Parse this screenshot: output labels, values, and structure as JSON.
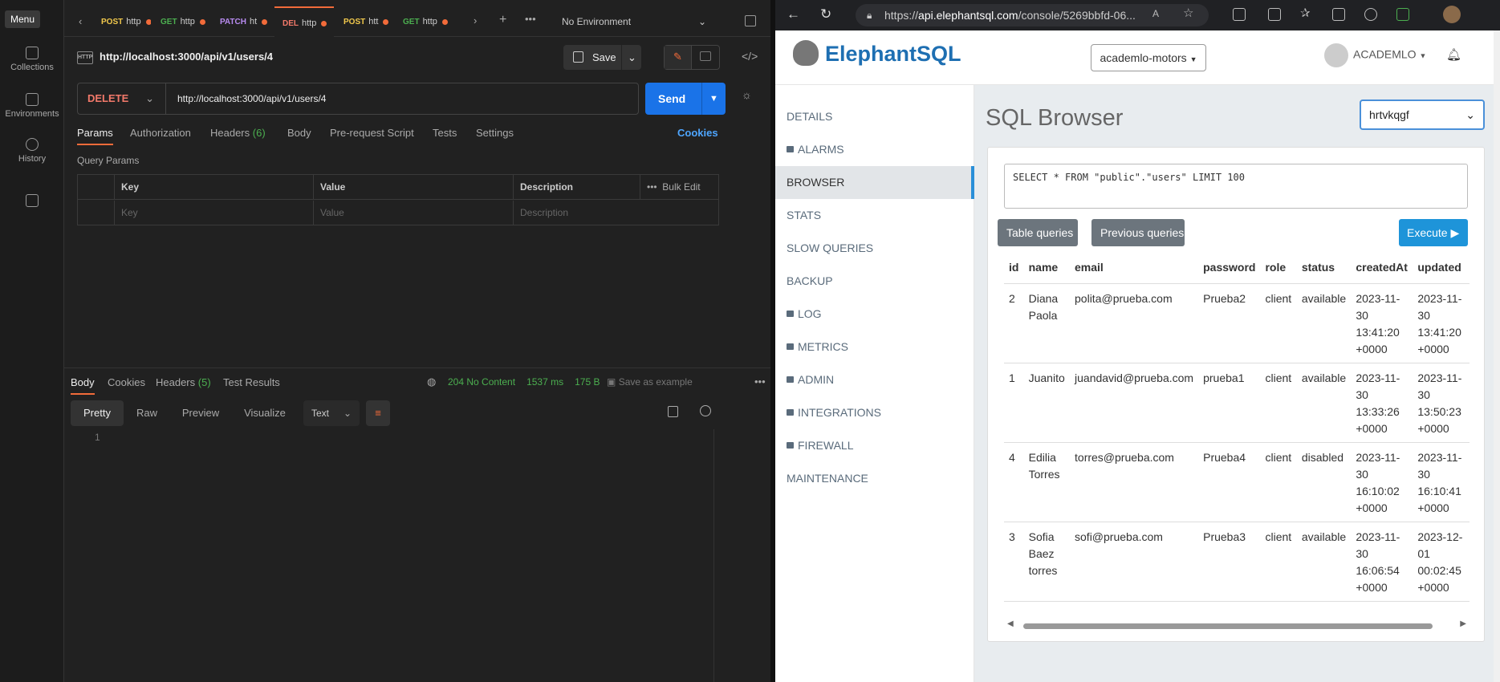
{
  "postman": {
    "sidebar": {
      "menu_label": "Menu",
      "items": [
        {
          "label": "Collections",
          "icon": "collections-icon"
        },
        {
          "label": "Environments",
          "icon": "environments-icon"
        },
        {
          "label": "History",
          "icon": "history-icon"
        },
        {
          "label": "",
          "icon": "add-workspace-icon"
        }
      ]
    },
    "tabs": [
      {
        "method": "POST",
        "text": "http",
        "color": "#f2c94c"
      },
      {
        "method": "GET",
        "text": "http",
        "color": "#4caf50"
      },
      {
        "method": "PATCH",
        "text": "ht",
        "color": "#b88bf0"
      },
      {
        "method": "DEL",
        "text": "http",
        "color": "#f2796a",
        "active": true
      },
      {
        "method": "POST",
        "text": "htt",
        "color": "#f2c94c"
      },
      {
        "method": "GET",
        "text": "http",
        "color": "#4caf50"
      }
    ],
    "environment": "No Environment",
    "request_title": "http://localhost:3000/api/v1/users/4",
    "http_badge": "HTTP",
    "save_label": "Save",
    "method": "DELETE",
    "url": "http://localhost:3000/api/v1/users/4",
    "send_label": "Send",
    "request_tabs": [
      {
        "label": "Params",
        "active": true
      },
      {
        "label": "Authorization"
      },
      {
        "label": "Headers",
        "count": "(6)"
      },
      {
        "label": "Body"
      },
      {
        "label": "Pre-request Script"
      },
      {
        "label": "Tests"
      },
      {
        "label": "Settings"
      }
    ],
    "cookies_link": "Cookies",
    "query_params_label": "Query Params",
    "params_table": {
      "headers": [
        "Key",
        "Value",
        "Description"
      ],
      "bulk_edit": "Bulk Edit",
      "placeholders": [
        "Key",
        "Value",
        "Description"
      ]
    },
    "response": {
      "tabs": [
        {
          "label": "Body",
          "active": true
        },
        {
          "label": "Cookies"
        },
        {
          "label": "Headers",
          "count": "(5)"
        },
        {
          "label": "Test Results"
        }
      ],
      "status": "204 No Content",
      "time": "1537 ms",
      "size": "175 B",
      "save_as_example": "Save as example",
      "format_tabs": [
        "Pretty",
        "Raw",
        "Preview",
        "Visualize"
      ],
      "text_format": "Text",
      "line_number": "1"
    }
  },
  "browser": {
    "url_prefix": "https://",
    "url_host": "api.elephantsql.com",
    "url_path": "/console/5269bbfd-06..."
  },
  "elephant": {
    "brand": "ElephantSQL",
    "instance": "academlo-motors",
    "user": "ACADEMLO",
    "nav": [
      {
        "label": "DETAILS"
      },
      {
        "label": "ALARMS",
        "lock": true
      },
      {
        "label": "BROWSER",
        "active": true
      },
      {
        "label": "STATS"
      },
      {
        "label": "SLOW QUERIES"
      },
      {
        "label": "BACKUP"
      },
      {
        "label": "LOG",
        "lock": true
      },
      {
        "label": "METRICS",
        "lock": true
      },
      {
        "label": "ADMIN",
        "lock": true
      },
      {
        "label": "INTEGRATIONS",
        "lock": true
      },
      {
        "label": "FIREWALL",
        "lock": true
      },
      {
        "label": "MAINTENANCE"
      }
    ],
    "title": "SQL Browser",
    "database": "hrtvkqgf",
    "query": "SELECT * FROM \"public\".\"users\" LIMIT 100",
    "table_queries": "Table queries",
    "previous_queries": "Previous queries",
    "execute": "Execute",
    "columns": [
      "id",
      "name",
      "email",
      "password",
      "role",
      "status",
      "createdAt",
      "updated"
    ],
    "rows": [
      [
        "2",
        "Diana Paola",
        "polita@prueba.com",
        "Prueba2",
        "client",
        "available",
        "2023-11-30 13:41:20 +0000",
        "2023-11-30 13:41:20 +0000"
      ],
      [
        "1",
        "Juanito",
        "juandavid@prueba.com",
        "prueba1",
        "client",
        "available",
        "2023-11-30 13:33:26 +0000",
        "2023-11-30 13:50:23 +0000"
      ],
      [
        "4",
        "Edilia Torres",
        "torres@prueba.com",
        "Prueba4",
        "client",
        "disabled",
        "2023-11-30 16:10:02 +0000",
        "2023-11-30 16:10:41 +0000"
      ],
      [
        "3",
        "Sofia Baez torres",
        "sofi@prueba.com",
        "Prueba3",
        "client",
        "available",
        "2023-11-30 16:06:54 +0000",
        "2023-12-01 00:02:45 +0000"
      ]
    ]
  }
}
